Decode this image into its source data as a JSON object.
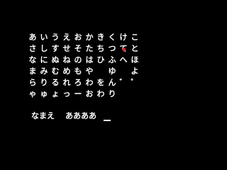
{
  "kana_rows": [
    [
      "あ",
      "い",
      "う",
      "え",
      "お",
      "か",
      "き",
      "く",
      "け",
      "こ"
    ],
    [
      "さ",
      "し",
      "す",
      "せ",
      "そ",
      "た",
      "ち",
      "つ",
      "て",
      "と"
    ],
    [
      "な",
      "に",
      "ぬ",
      "ね",
      "の",
      "は",
      "ひ",
      "ふ",
      "へ",
      "ほ"
    ],
    [
      "ま",
      "み",
      "む",
      "め",
      "も",
      "や",
      "",
      "ゆ",
      "",
      "よ"
    ],
    [
      "ら",
      "り",
      "る",
      "れ",
      "ろ",
      "わ",
      "を",
      "ん",
      "゛",
      "゜"
    ],
    [
      "ゃ",
      "ゅ",
      "ょ",
      "っ",
      "ー",
      "お",
      "わ",
      "り",
      "",
      ""
    ]
  ],
  "selected_cell": {
    "row": 1,
    "col": 8
  },
  "cursor_color": "#e02020",
  "name_entry": {
    "label": "なまえ",
    "value": "ああああ"
  }
}
